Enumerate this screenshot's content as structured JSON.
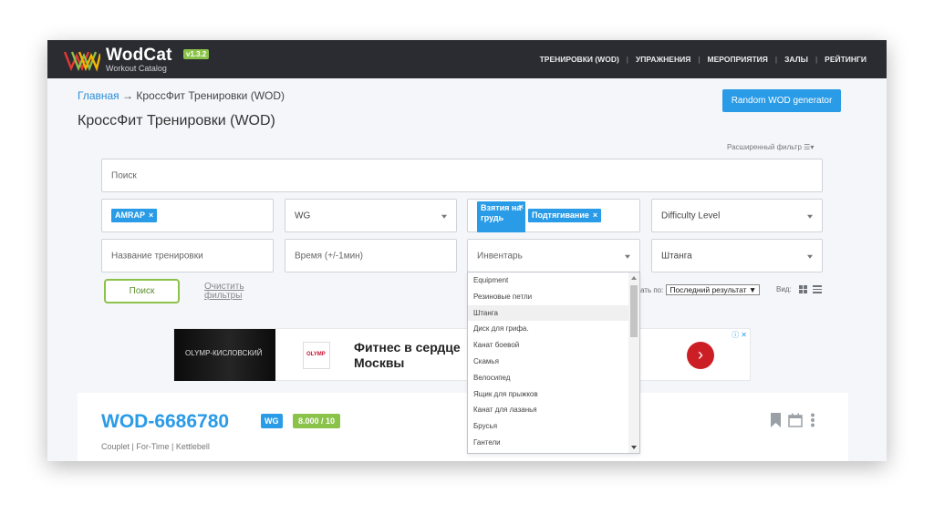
{
  "header": {
    "logo_name": "WodCat",
    "logo_sub": "Workout Catalog",
    "version": "v1.3.2",
    "nav": [
      "ТРЕНИРОВКИ (WOD)",
      "УПРАЖНЕНИЯ",
      "МЕРОПРИЯТИЯ",
      "ЗАЛЫ",
      "РЕЙТИНГИ"
    ]
  },
  "breadcrumb": {
    "home": "Главная",
    "arrow": "→",
    "current": "КроссФит Тренировки (WOD)"
  },
  "page_title": "КроссФит Тренировки (WOD)",
  "random_button": "Random WOD generator",
  "advanced_filter": "Расширенный фильтр ☰▾",
  "filters": {
    "search_placeholder": "Поиск",
    "type_tag": "AMRAP",
    "tag_close": "×",
    "wg_select": "WG",
    "exercise_tags": [
      "Взятия на грудь",
      "Подтягивание"
    ],
    "difficulty_select": "Difficulty Level",
    "name_placeholder": "Название тренировки",
    "time_placeholder": "Время (+/-1мин)",
    "inventory_select": "Инвентарь",
    "barbell_select": "Штанга"
  },
  "actions": {
    "search_button": "Поиск",
    "clear_link": "Очистить фильтры",
    "sort_label": "ать по:",
    "sort_value": "Последний результат ▼",
    "view_label": "Вид:"
  },
  "ad": {
    "brand": "OLYMP-КИСЛОВСКИЙ",
    "logo": "OLYMP",
    "headline": "Фитнес в сердце Москвы",
    "go": "›",
    "info": "ⓘ ✕"
  },
  "card": {
    "title": "WOD-6686780",
    "wg_badge": "WG",
    "score": "8.000 / 10",
    "meta": "Couplet |  For-Time |  Kettlebell"
  },
  "dropdown": {
    "items": [
      "Equipment",
      "Резиновые петли",
      "Штанга",
      "Диск для грифа.",
      "Канат боевой",
      "Скамья",
      "Велосипед",
      "Ящик для прыжков",
      "Канат для лазанья",
      "Брусья",
      "Гантели"
    ],
    "selected_index": 2
  }
}
